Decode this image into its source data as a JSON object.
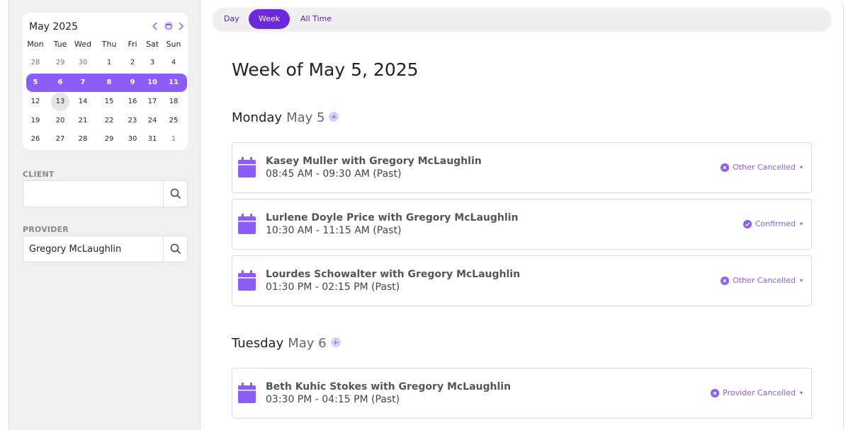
{
  "calendar": {
    "title": "May 2025",
    "weekdays": [
      "Mon",
      "Tue",
      "Wed",
      "Thu",
      "Fri",
      "Sat",
      "Sun"
    ],
    "weeks": [
      [
        "28",
        "29",
        "30",
        "1",
        "2",
        "3",
        "4"
      ],
      [
        "5",
        "6",
        "7",
        "8",
        "9",
        "10",
        "11"
      ],
      [
        "12",
        "13",
        "14",
        "15",
        "16",
        "17",
        "18"
      ],
      [
        "19",
        "20",
        "21",
        "22",
        "23",
        "24",
        "25"
      ],
      [
        "26",
        "27",
        "28",
        "29",
        "30",
        "31",
        "1"
      ]
    ],
    "selected_week_index": 1,
    "today": "13",
    "accent": "#8b5cf6"
  },
  "client": {
    "label": "CLIENT",
    "value": ""
  },
  "provider": {
    "label": "PROVIDER",
    "value": "Gregory McLaughlin"
  },
  "tabs": [
    {
      "label": "Day",
      "active": false
    },
    {
      "label": "Week",
      "active": true
    },
    {
      "label": "All Time",
      "active": false
    }
  ],
  "week_title": "Week of May 5, 2025",
  "days": [
    {
      "weekday": "Monday",
      "date": "May 5",
      "appointments": [
        {
          "name": "Kasey Muller with Gregory McLaughlin",
          "time": "08:45 AM - 09:30 AM (Past)",
          "status": "Other Cancelled",
          "status_icon": "x-circle-icon"
        },
        {
          "name": "Lurlene Doyle Price with Gregory McLaughlin",
          "time": "10:30 AM - 11:15 AM (Past)",
          "status": "Confirmed",
          "status_icon": "check-circle-icon"
        },
        {
          "name": "Lourdes Schowalter with Gregory McLaughlin",
          "time": "01:30 PM - 02:15 PM (Past)",
          "status": "Other Cancelled",
          "status_icon": "x-circle-icon"
        }
      ]
    },
    {
      "weekday": "Tuesday",
      "date": "May 6",
      "appointments": [
        {
          "name": "Beth Kuhic Stokes with Gregory McLaughlin",
          "time": "03:30 PM - 04:15 PM (Past)",
          "status": "Provider Cancelled",
          "status_icon": "x-circle-icon"
        }
      ]
    }
  ],
  "colors": {
    "accent": "#8b5cf6",
    "active_tab": "#6d28d9"
  }
}
